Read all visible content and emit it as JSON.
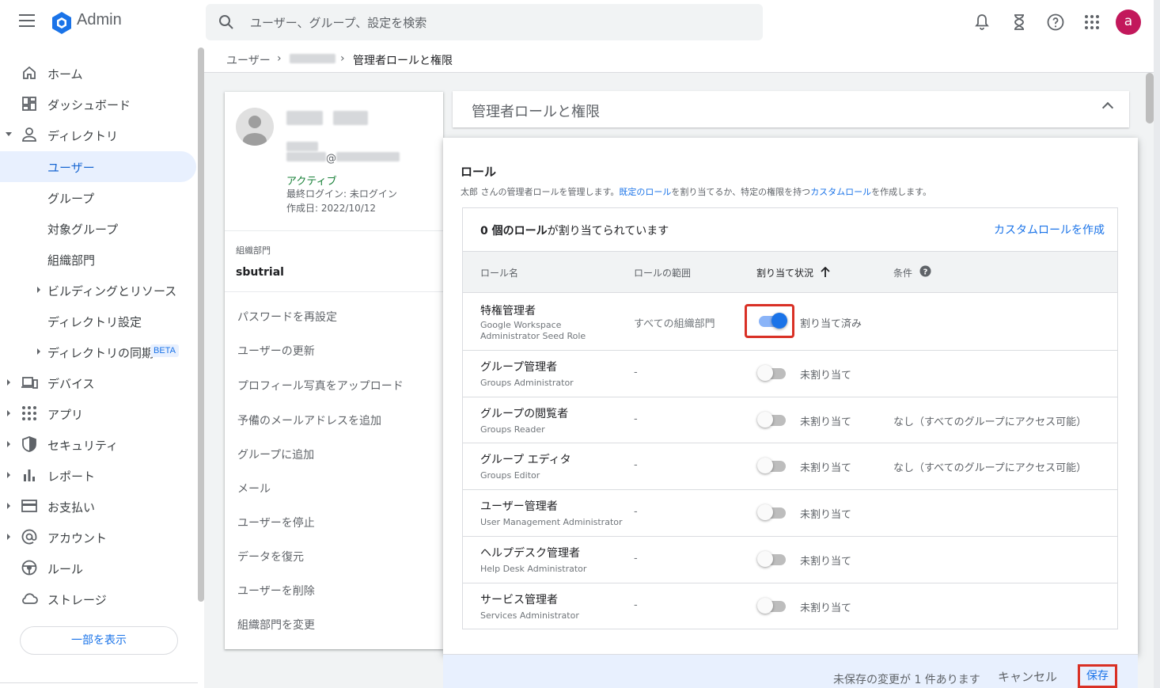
{
  "app": {
    "title": "Admin"
  },
  "search": {
    "placeholder": "ユーザー、グループ、設定を検索"
  },
  "user": {
    "avatar_letter": "a"
  },
  "sidebar": {
    "items": [
      {
        "label": "ホーム",
        "icon": "home-icon"
      },
      {
        "label": "ダッシュボード",
        "icon": "dashboard-icon"
      },
      {
        "label": "ディレクトリ",
        "icon": "person-icon"
      },
      {
        "label": "ユーザー"
      },
      {
        "label": "グループ"
      },
      {
        "label": "対象グループ"
      },
      {
        "label": "組織部門"
      },
      {
        "label": "ビルディングとリソース"
      },
      {
        "label": "ディレクトリ設定"
      },
      {
        "label": "ディレクトリの同期",
        "badge": "BETA"
      },
      {
        "label": "デバイス",
        "icon": "devices-icon"
      },
      {
        "label": "アプリ",
        "icon": "apps-icon"
      },
      {
        "label": "セキュリティ",
        "icon": "shield-icon"
      },
      {
        "label": "レポート",
        "icon": "bar-chart-icon"
      },
      {
        "label": "お支払い",
        "icon": "credit-card-icon"
      },
      {
        "label": "アカウント",
        "icon": "at-icon"
      },
      {
        "label": "ルール",
        "icon": "rules-icon"
      },
      {
        "label": "ストレージ",
        "icon": "cloud-icon"
      }
    ],
    "show_less": "一部を表示"
  },
  "breadcrumb": {
    "users": "ユーザー",
    "current": "管理者ロールと権限"
  },
  "profile": {
    "status": "アクティブ",
    "last_login": "最終ログイン: 未ログイン",
    "created": "作成日: 2022/10/12",
    "org_label": "組織部門",
    "org_value": "sbutrial",
    "actions": [
      "パスワードを再設定",
      "ユーザーの更新",
      "プロフィール写真をアップロード",
      "予備のメールアドレスを追加",
      "グループに追加",
      "メール",
      "ユーザーを停止",
      "データを復元",
      "ユーザーを削除",
      "組織部門を変更"
    ]
  },
  "roles": {
    "header": "管理者ロールと権限",
    "title": "ロール",
    "desc_1": "太郎 さんの管理者ロールを管理します。",
    "desc_link1": "既定のロール",
    "desc_2": "を割り当てるか、特定の権限を持つ",
    "desc_link2": "カスタムロール",
    "desc_3": "を作成します。",
    "count_bold": "0 個のロール",
    "count_rest": "が割り当てられています",
    "create_custom": "カスタムロールを作成",
    "columns": {
      "name": "ロール名",
      "scope": "ロールの範囲",
      "status": "割り当て状況",
      "condition": "条件"
    },
    "rows": [
      {
        "name": "特権管理者",
        "sub": "Google Workspace Administrator Seed Role",
        "scope": "すべての組織部門",
        "status": "割り当て済み",
        "on": true,
        "condition": ""
      },
      {
        "name": "グループ管理者",
        "sub": "Groups Administrator",
        "scope": "-",
        "status": "未割り当て",
        "on": false,
        "condition": ""
      },
      {
        "name": "グループの閲覧者",
        "sub": "Groups Reader",
        "scope": "-",
        "status": "未割り当て",
        "on": false,
        "condition": "なし（すべてのグループにアクセス可能）"
      },
      {
        "name": "グループ エディタ",
        "sub": "Groups Editor",
        "scope": "-",
        "status": "未割り当て",
        "on": false,
        "condition": "なし（すべてのグループにアクセス可能）"
      },
      {
        "name": "ユーザー管理者",
        "sub": "User Management Administrator",
        "scope": "-",
        "status": "未割り当て",
        "on": false,
        "condition": ""
      },
      {
        "name": "ヘルプデスク管理者",
        "sub": "Help Desk Administrator",
        "scope": "-",
        "status": "未割り当て",
        "on": false,
        "condition": ""
      },
      {
        "name": "サービス管理者",
        "sub": "Services Administrator",
        "scope": "-",
        "status": "未割り当て",
        "on": false,
        "condition": ""
      }
    ]
  },
  "footer": {
    "unsaved": "未保存の変更が 1 件あります",
    "cancel": "キャンセル",
    "save": "保存"
  },
  "colors": {
    "accent": "#1a73e8",
    "highlight": "#d93025",
    "avatar": "#c2185b"
  }
}
